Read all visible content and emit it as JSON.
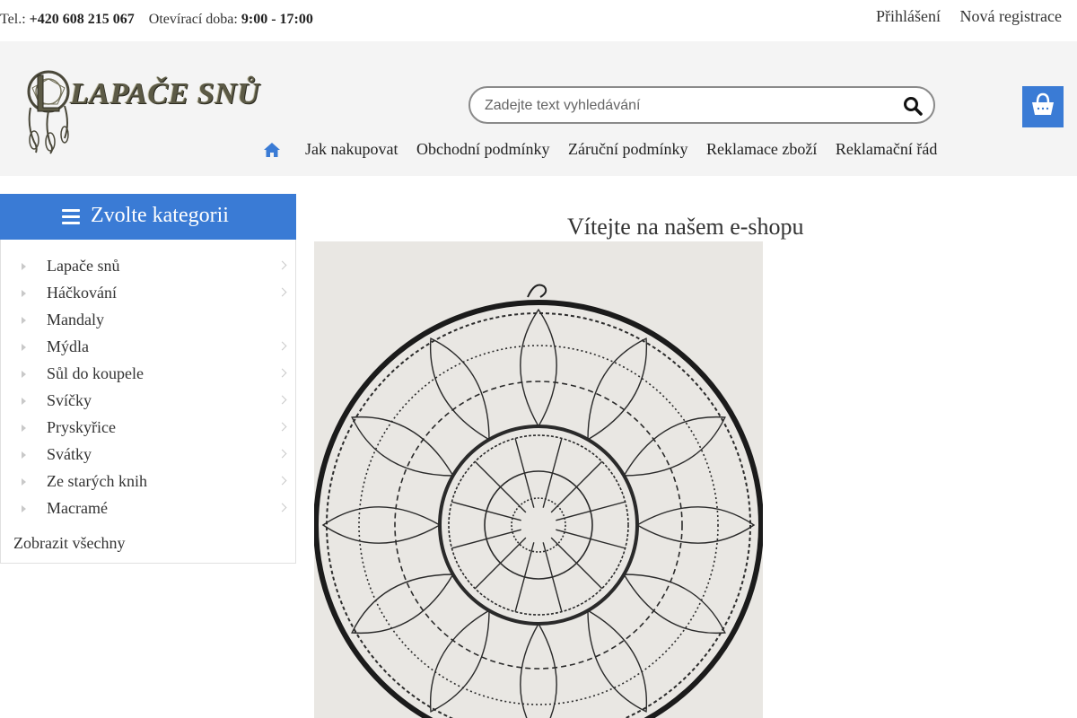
{
  "topbar": {
    "phone_label": "Tel.:",
    "phone": "+420 608 215 067",
    "hours_label": "Otevírací doba:",
    "hours": "9:00 - 17:00",
    "login": "Přihlášení",
    "register": "Nová registrace"
  },
  "header": {
    "logo_text": "LAPAČE SNŮ",
    "search": {
      "placeholder": "Zadejte text vyhledávání",
      "value": ""
    },
    "nav": [
      "Jak nakupovat",
      "Obchodní podmínky",
      "Záruční podmínky",
      "Reklamace zboží",
      "Reklamační řád"
    ]
  },
  "sidebar": {
    "heading": "Zvolte kategorii",
    "items": [
      {
        "label": "Lapače snů",
        "has_sub": true
      },
      {
        "label": "Háčkování",
        "has_sub": true
      },
      {
        "label": "Mandaly",
        "has_sub": false
      },
      {
        "label": "Mýdla",
        "has_sub": true
      },
      {
        "label": "Sůl do koupele",
        "has_sub": true
      },
      {
        "label": "Svíčky",
        "has_sub": true
      },
      {
        "label": "Pryskyřice",
        "has_sub": true
      },
      {
        "label": "Svátky",
        "has_sub": true
      },
      {
        "label": "Ze starých knih",
        "has_sub": true
      },
      {
        "label": "Macramé",
        "has_sub": true
      }
    ],
    "show_all": "Zobrazit všechny"
  },
  "main": {
    "welcome": "Vítejte na našem e-shopu"
  },
  "colors": {
    "accent": "#3a7bd5",
    "header_bg": "#f4f4f4",
    "text": "#333333"
  },
  "icons": {
    "cart": "shopping-basket-icon",
    "search": "search-icon",
    "home": "home-icon",
    "menu": "hamburger-icon"
  }
}
